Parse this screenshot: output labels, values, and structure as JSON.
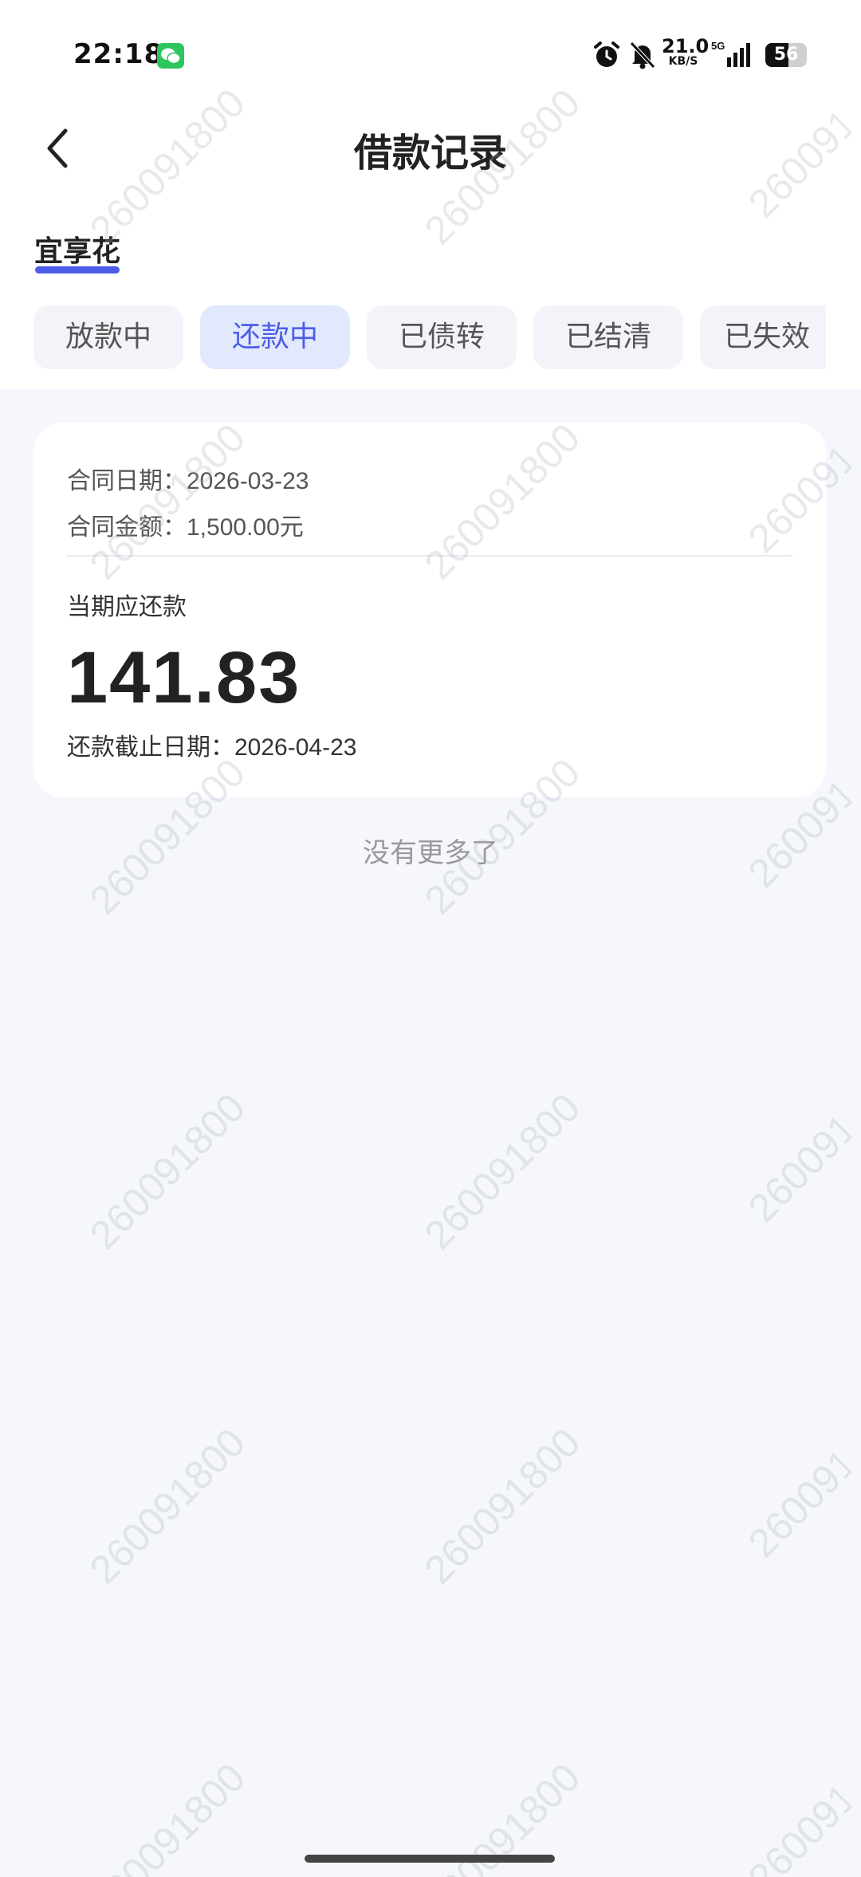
{
  "status_bar": {
    "time": "22:18",
    "net_speed_value": "21.0",
    "net_speed_unit": "KB/S",
    "network_type": "5G",
    "battery": "56",
    "battery_level_percent": 56
  },
  "header": {
    "title": "借款记录"
  },
  "product_tab": {
    "label": "宜享花"
  },
  "filters": [
    {
      "label": "放款中",
      "active": false
    },
    {
      "label": "还款中",
      "active": true
    },
    {
      "label": "已债转",
      "active": false
    },
    {
      "label": "已结清",
      "active": false
    },
    {
      "label": "已失效",
      "active": false
    }
  ],
  "loan_card": {
    "contract_date_label": "合同日期：",
    "contract_date": "2026-03-23",
    "contract_amount_label": "合同金额：",
    "contract_amount": "1,500.00元",
    "due_label": "当期应还款",
    "due_amount": "141.83",
    "deadline_label": "还款截止日期：",
    "deadline": "2026-04-23"
  },
  "list_footer": "没有更多了",
  "watermark": "260091800",
  "colors": {
    "accent": "#4e5de8",
    "active_pill_bg": "#e3e9fc",
    "page_bg": "#f5f7fc"
  }
}
